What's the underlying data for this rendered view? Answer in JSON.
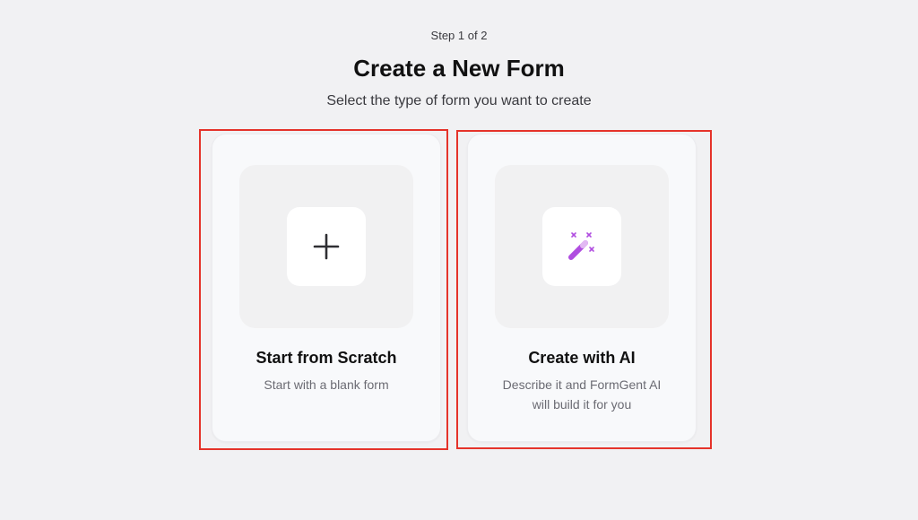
{
  "header": {
    "step": "Step 1 of 2",
    "title": "Create a New Form",
    "subtitle": "Select the type of form you want to create"
  },
  "options": [
    {
      "title": "Start from Scratch",
      "description": "Start with a blank form",
      "icon": "plus-icon"
    },
    {
      "title": "Create with AI",
      "description": "Describe it and FormGent AI will build it for you",
      "icon": "magic-wand-icon"
    }
  ],
  "colors": {
    "background": "#f1f1f3",
    "highlight": "#e5332a",
    "ai_accent": "#b04de0"
  }
}
